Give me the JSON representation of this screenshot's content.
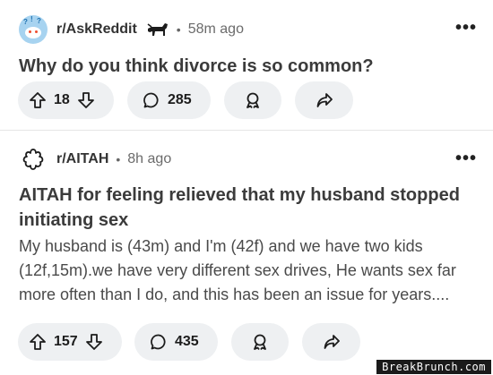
{
  "posts": [
    {
      "subreddit": "r/AskReddit",
      "time": "58m ago",
      "separator": "•",
      "more_icon": "kebab-dots-icon",
      "title": "Why do you think divorce is so common?",
      "upvotes": "18",
      "comments": "285"
    },
    {
      "subreddit": "r/AITAH",
      "time": "8h ago",
      "separator": "•",
      "more_icon": "kebab-dots-icon",
      "title_lines": [
        "AITAH for feeling relieved that my husband stopped",
        "initiating sex"
      ],
      "body_lines": [
        "My husband is (43m) and I'm (42f) and we have two kids",
        "(12f,15m).we have very different sex drives, He wants sex far",
        "more often than I do, and this has been an issue for years...."
      ],
      "upvotes": "157",
      "comments": "435"
    }
  ],
  "kebab": "•••",
  "watermark": "BreakBrunch.com",
  "colors": {
    "pill_bg": "#eef0f2",
    "title": "#3b3b3b",
    "body": "#4a4a4a",
    "avatar_bg": "#a7d3f0"
  }
}
